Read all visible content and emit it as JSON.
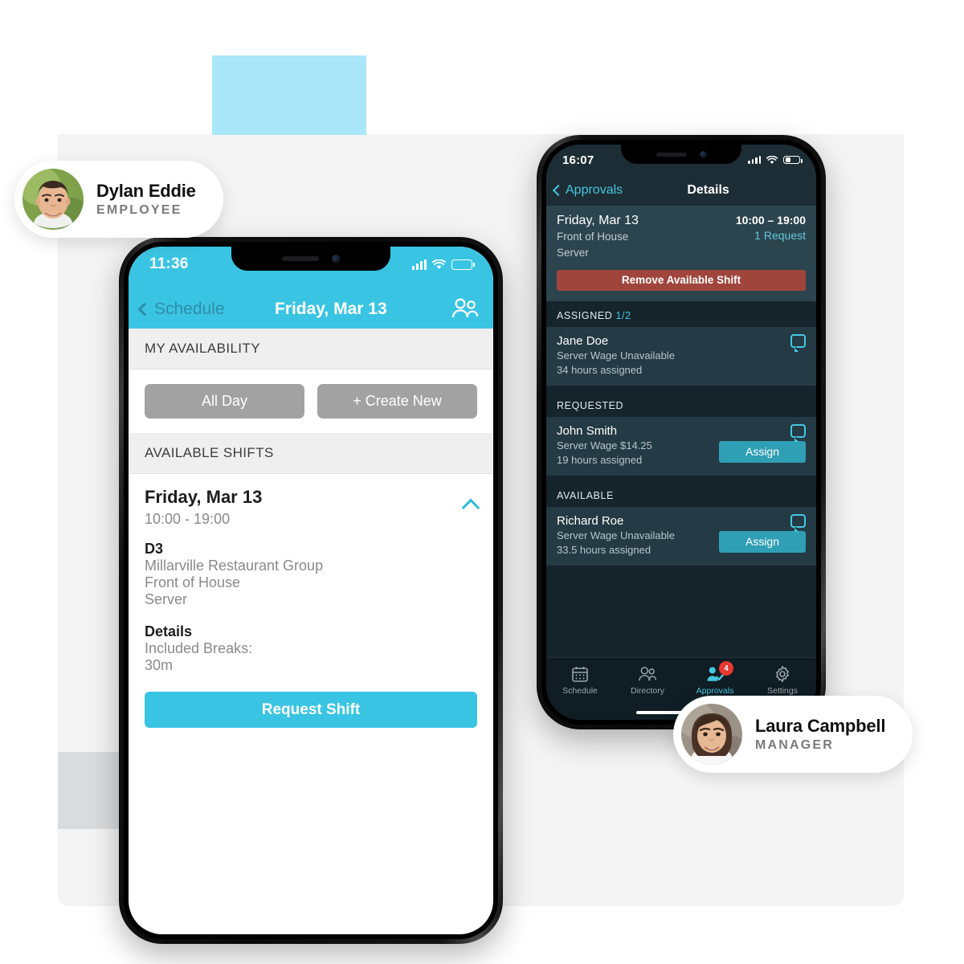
{
  "employee_phone": {
    "status_bar": {
      "time": "11:36",
      "signal_icon": "cellular-bars-icon",
      "wifi_icon": "wifi-icon",
      "battery_icon": "battery-icon"
    },
    "navbar": {
      "back_label": "Schedule",
      "back_icon": "chevron-left-icon",
      "title": "Friday, Mar 13",
      "people_icon": "people-icon"
    },
    "availability_section": {
      "header": "MY AVAILABILITY",
      "buttons": [
        "All Day",
        "+ Create New"
      ]
    },
    "shifts_section": {
      "header": "AVAILABLE SHIFTS"
    },
    "shift_card": {
      "day": "Friday, Mar 13",
      "time": "10:00 - 19:00",
      "collapse_icon": "chevron-up-icon",
      "code": "D3",
      "company": "Millarville Restaurant Group",
      "department": "Front of House",
      "role": "Server",
      "details_label": "Details",
      "breaks_label": "Included Breaks:",
      "breaks_value": "30m",
      "cta": "Request Shift"
    },
    "accent_color": "#3ac4e3"
  },
  "manager_phone": {
    "status_bar": {
      "time": "16:07",
      "signal_icon": "cellular-bars-icon",
      "wifi_icon": "wifi-icon",
      "battery_icon": "battery-icon"
    },
    "navbar": {
      "back_label": "Approvals",
      "back_icon": "chevron-left-icon",
      "title": "Details"
    },
    "shift_card": {
      "day": "Friday, Mar 13",
      "department": "Front of House",
      "role": "Server",
      "time": "10:00 – 19:00",
      "requests": "1 Request",
      "remove_button": "Remove Available Shift"
    },
    "sections": [
      {
        "header": "ASSIGNED",
        "count": "1/2",
        "rows": [
          {
            "name": "Jane Doe",
            "wage": "Server Wage Unavailable",
            "hours": "34 hours assigned",
            "chat_icon": "chat-bubble-icon",
            "action": null
          }
        ]
      },
      {
        "header": "REQUESTED",
        "count": "",
        "rows": [
          {
            "name": "John Smith",
            "wage": "Server Wage $14.25",
            "hours": "19 hours assigned",
            "chat_icon": "chat-bubble-icon",
            "action": "Assign"
          }
        ]
      },
      {
        "header": "AVAILABLE",
        "count": "",
        "rows": [
          {
            "name": "Richard Roe",
            "wage": "Server Wage Unavailable",
            "hours": "33.5 hours assigned",
            "chat_icon": "chat-bubble-icon",
            "action": "Assign"
          }
        ]
      }
    ],
    "tabs": [
      {
        "label": "Schedule",
        "icon": "calendar-icon",
        "active": false,
        "badge": ""
      },
      {
        "label": "Directory",
        "icon": "people-icon",
        "active": false,
        "badge": ""
      },
      {
        "label": "Approvals",
        "icon": "person-check-icon",
        "active": true,
        "badge": "4"
      },
      {
        "label": "Settings",
        "icon": "gear-icon",
        "active": false,
        "badge": ""
      }
    ],
    "accent_color": "#45c8e0",
    "danger_color": "#a0453c",
    "badge_color": "#e8382f"
  },
  "people": {
    "employee": {
      "name": "Dylan Eddie",
      "role": "EMPLOYEE",
      "avatar": "employee-avatar"
    },
    "manager": {
      "name": "Laura Campbell",
      "role": "MANAGER",
      "avatar": "manager-avatar"
    }
  }
}
